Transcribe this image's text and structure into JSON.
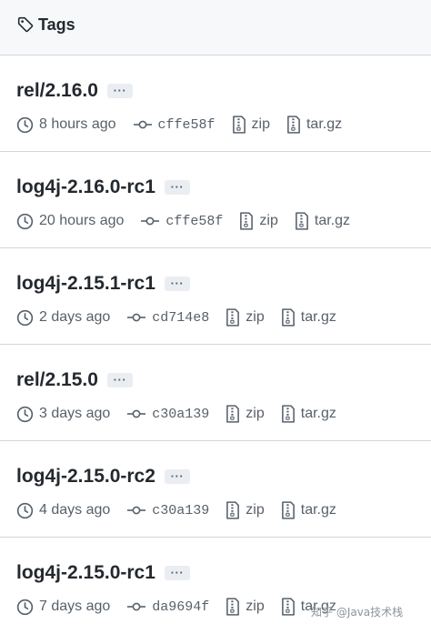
{
  "header": {
    "title": "Tags",
    "icon": "tag-icon"
  },
  "more_label": "···",
  "tags": [
    {
      "name": "rel/2.16.0",
      "time": "8 hours ago",
      "commit": "cffe58f",
      "zip": "zip",
      "targz": "tar.gz"
    },
    {
      "name": "log4j-2.16.0-rc1",
      "time": "20 hours ago",
      "commit": "cffe58f",
      "zip": "zip",
      "targz": "tar.gz"
    },
    {
      "name": "log4j-2.15.1-rc1",
      "time": "2 days ago",
      "commit": "cd714e8",
      "zip": "zip",
      "targz": "tar.gz"
    },
    {
      "name": "rel/2.15.0",
      "time": "3 days ago",
      "commit": "c30a139",
      "zip": "zip",
      "targz": "tar.gz"
    },
    {
      "name": "log4j-2.15.0-rc2",
      "time": "4 days ago",
      "commit": "c30a139",
      "zip": "zip",
      "targz": "tar.gz"
    },
    {
      "name": "log4j-2.15.0-rc1",
      "time": "7 days ago",
      "commit": "da9694f",
      "zip": "zip",
      "targz": "tar.gz"
    }
  ],
  "watermark": "知乎 @Java技术栈"
}
